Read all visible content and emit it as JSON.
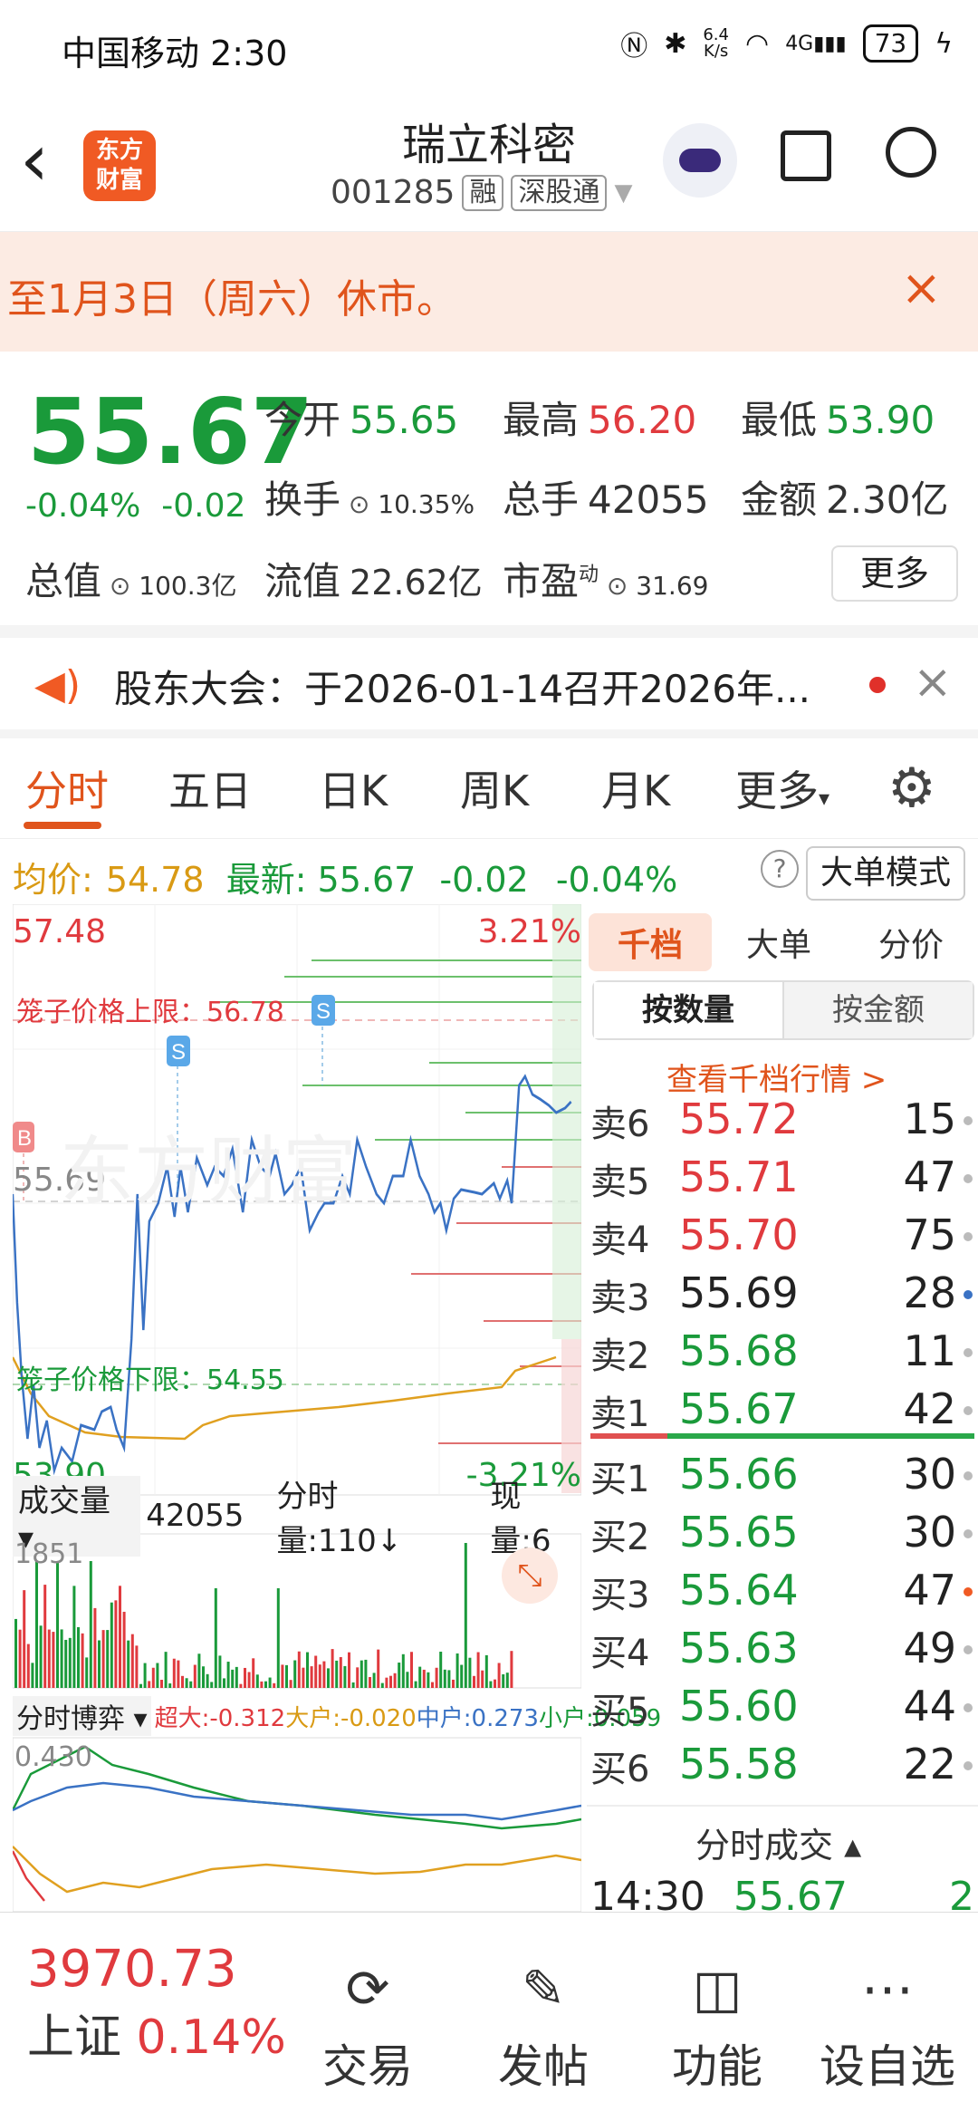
{
  "status": {
    "carrier": "中国移动",
    "time": "2:30",
    "speed_top": "6.4",
    "speed_bottom": "K/s",
    "network": "4G",
    "battery": "73"
  },
  "header": {
    "title": "瑞立科密",
    "code": "001285",
    "tag1": "融",
    "tag2": "深股通",
    "logo_line1": "东方",
    "logo_line2": "财富"
  },
  "banner": {
    "text": "至1月3日（周六）休市。",
    "close": "×"
  },
  "quote": {
    "price": "55.67",
    "change_pct": "-0.04%",
    "change": "-0.02",
    "open_label": "今开",
    "open": "55.65",
    "high_label": "最高",
    "high": "56.20",
    "low_label": "最低",
    "low": "53.90",
    "turnover_label": "换手",
    "turnover": "10.35%",
    "volume_label": "总手",
    "volume": "42055",
    "amount_label": "金额",
    "amount": "2.30亿",
    "mktcap_label": "总值",
    "mktcap": "100.3亿",
    "float_label": "流值",
    "float": "22.62亿",
    "pe_label": "市盈",
    "pe_sup": "动",
    "pe": "31.69",
    "more": "更多"
  },
  "notice": {
    "text": "股东大会：于2026-01-14召开2026年..."
  },
  "tabs": [
    "分时",
    "五日",
    "日K",
    "周K",
    "月K",
    "更多"
  ],
  "info": {
    "avg_label": "均价:",
    "avg": "54.78",
    "last_label": "最新:",
    "last": "55.67",
    "chg": "-0.02",
    "pct": "-0.04%",
    "mode_btn": "大单模式"
  },
  "chart": {
    "top_price": "57.48",
    "top_pct": "3.21%",
    "mid_price": "55.69",
    "bottom_price": "53.90",
    "bottom_pct": "-3.21%",
    "cage_upper": "笼子价格上限：56.78",
    "cage_lower": "笼子价格下限：54.55",
    "marker_b": "B",
    "marker_s": "S",
    "watermark": "东方财富",
    "vol_label": "成交量",
    "vol_total": "42055",
    "vol_min": "分时量:110↓",
    "vol_now": "现量:6",
    "vol_max": "1851",
    "game_label": "分时博弈",
    "game_super": "超大:-0.312",
    "game_big": "大户:-0.020",
    "game_mid": "中户:0.273",
    "game_small": "小户:0.059",
    "game_top": "0.430",
    "accent_colors": {
      "price_line": "#3a72c4",
      "avg_line": "#e0a020",
      "up": "#e03a3e",
      "down": "#1a9a3a"
    }
  },
  "book": {
    "tabs": [
      "千档",
      "大单",
      "分价"
    ],
    "seg_on": "按数量",
    "seg_off": "按金额",
    "link": "查看千档行情 >",
    "asks": [
      {
        "label": "卖6",
        "price": "55.72",
        "vol": "15"
      },
      {
        "label": "卖5",
        "price": "55.71",
        "vol": "47"
      },
      {
        "label": "卖4",
        "price": "55.70",
        "vol": "75"
      },
      {
        "label": "卖3",
        "price": "55.69",
        "vol": "28"
      },
      {
        "label": "卖2",
        "price": "55.68",
        "vol": "11"
      },
      {
        "label": "卖1",
        "price": "55.67",
        "vol": "42"
      }
    ],
    "bids": [
      {
        "label": "买1",
        "price": "55.66",
        "vol": "30"
      },
      {
        "label": "买2",
        "price": "55.65",
        "vol": "30"
      },
      {
        "label": "买3",
        "price": "55.64",
        "vol": "47"
      },
      {
        "label": "买4",
        "price": "55.63",
        "vol": "49"
      },
      {
        "label": "买5",
        "price": "55.60",
        "vol": "44"
      },
      {
        "label": "买6",
        "price": "55.58",
        "vol": "22"
      }
    ],
    "trades_label": "分时成交 ▴",
    "trade_time": "14:30",
    "trade_price": "55.67",
    "trade_vol": "2"
  },
  "bottom": {
    "index_value": "3970.73",
    "index_name": "上证",
    "index_pct": "0.14%",
    "items": [
      "交易",
      "发帖",
      "功能",
      "设自选"
    ]
  }
}
